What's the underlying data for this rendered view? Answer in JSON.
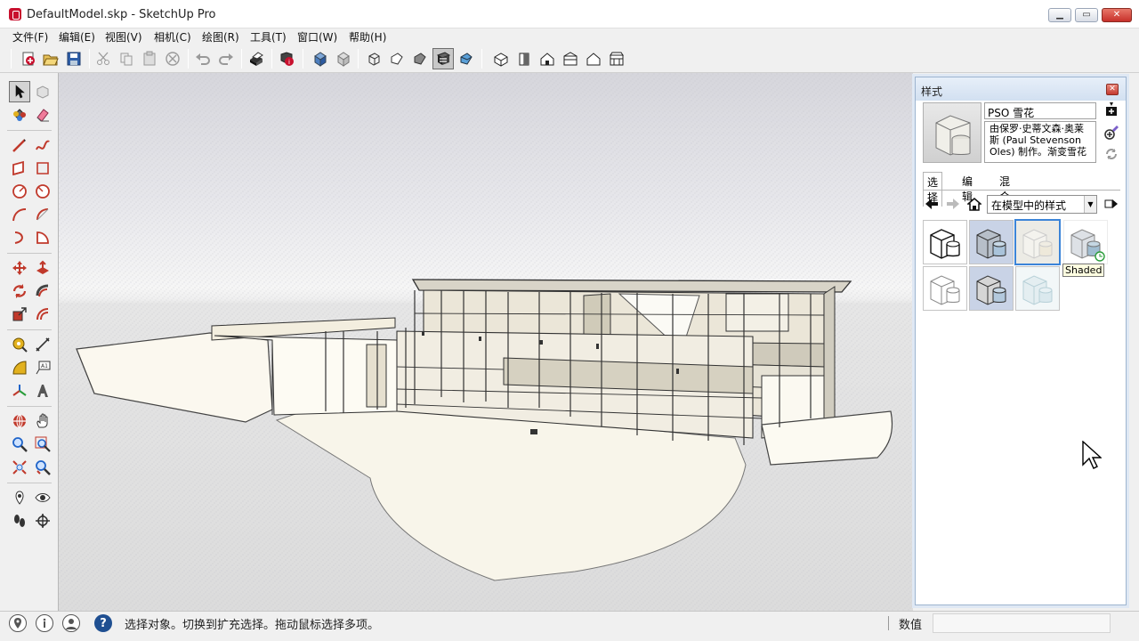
{
  "window": {
    "title": "DefaultModel.skp - SketchUp Pro",
    "minimize": "▁",
    "maximize": "▭",
    "close": "✕"
  },
  "menu": [
    "文件(F)",
    "编辑(E)",
    "视图(V)",
    "相机(C)",
    "绘图(R)",
    "工具(T)",
    "窗口(W)",
    "帮助(H)"
  ],
  "toolbar": {
    "groups": [
      [
        "new-icon",
        "open-icon",
        "save-icon"
      ],
      [
        "cut-icon",
        "copy-icon",
        "paste-icon",
        "erase-icon"
      ],
      [
        "undo-icon",
        "redo-icon"
      ],
      [
        "print-icon"
      ],
      [
        "model-info-icon"
      ],
      [
        "3d-warehouse-icon",
        "share-model-icon"
      ],
      [
        "xray-icon",
        "wireframe-icon",
        "hidden-line-icon",
        "shaded-icon",
        "shaded-textures-icon"
      ],
      [
        "iso-view-icon",
        "top-view-icon",
        "front-view-icon",
        "right-view-icon",
        "back-view-icon",
        "left-view-icon"
      ]
    ],
    "active": "shaded-icon"
  },
  "left_tools": [
    [
      "select-icon",
      "component-icon"
    ],
    [
      "paint-bucket-icon",
      "eraser-icon"
    ],
    [
      "line-icon",
      "freehand-icon"
    ],
    [
      "rectangle-icon",
      "rotated-rectangle-icon"
    ],
    [
      "circle-icon",
      "polygon-icon"
    ],
    [
      "arc-icon",
      "two-point-arc-icon"
    ],
    [
      "three-point-arc-icon",
      "pie-icon"
    ],
    [
      "move-icon",
      "push-pull-icon"
    ],
    [
      "rotate-icon",
      "follow-me-icon"
    ],
    [
      "scale-icon",
      "offset-icon"
    ],
    [
      "tape-measure-icon",
      "dimension-icon"
    ],
    [
      "protractor-icon",
      "text-icon"
    ],
    [
      "axes-icon",
      "3d-text-icon"
    ],
    [
      "orbit-icon",
      "pan-icon"
    ],
    [
      "zoom-icon",
      "zoom-window-icon"
    ],
    [
      "zoom-extents-icon",
      "previous-view-icon"
    ],
    [
      "position-camera-icon",
      "look-around-icon"
    ],
    [
      "walk-icon",
      "section-plane-icon"
    ]
  ],
  "styles_panel": {
    "title": "样式",
    "close": "✕",
    "style_name": "PSO 雪花",
    "description": "由保罗·史蒂文森·奥莱斯 (Paul Stevenson Oles) 制作。渐变雪花",
    "tabs": [
      "选择",
      "编辑",
      "混合"
    ],
    "selected_tab": "选择",
    "collection": "在模型中的样式",
    "dropdown_arrow": "▼",
    "tooltip": "Shaded",
    "selected_index": 2
  },
  "status": {
    "text": "选择对象。切换到扩充选择。拖动鼠标选择多项。",
    "value_label": "数值",
    "help": "?"
  }
}
